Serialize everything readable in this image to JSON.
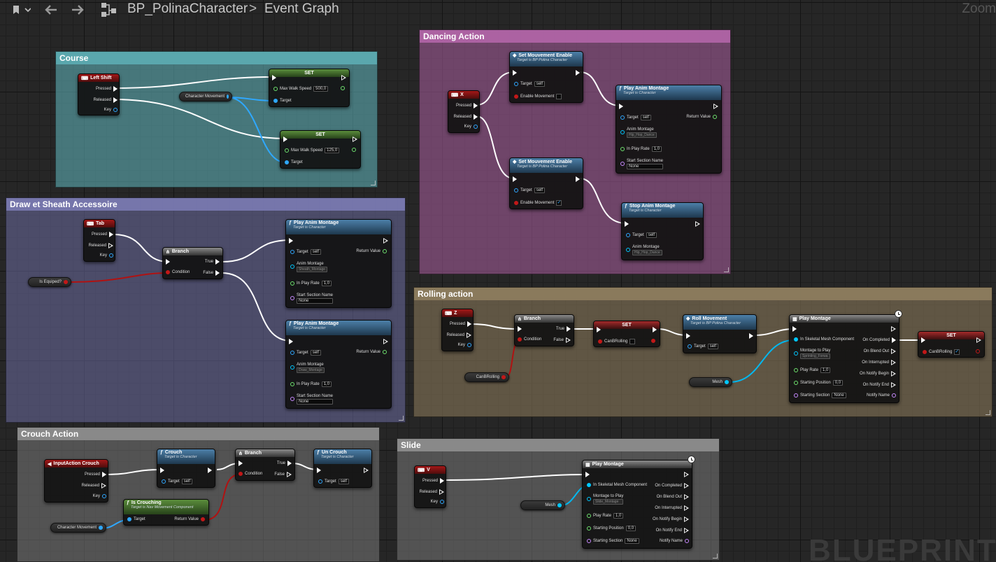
{
  "topbar": {
    "asset": "BP_PolinaCharacter",
    "graph": "Event Graph",
    "zoom": "Zoom"
  },
  "comments": {
    "course": "Course",
    "draw": "Draw et Sheath Accessoire",
    "dancing": "Dancing Action",
    "rolling": "Rolling action",
    "crouch": "Crouch Action",
    "slide": "Slide"
  },
  "labels": {
    "pressed": "Pressed",
    "released": "Released",
    "key": "Key",
    "set": "SET",
    "branch": "Branch",
    "true": "True",
    "false": "False",
    "condition": "Condition",
    "target": "Target",
    "self": "self",
    "max_walk_speed": "Max Walk Speed",
    "return_value": "Return Value",
    "anim_montage": "Anim Montage",
    "in_play_rate": "In Play Rate",
    "start_section_name": "Start Section Name",
    "none": "None",
    "rate_1": "1,0",
    "enable_movement": "Enable Movement",
    "target_is_bp": "Target is BP Polina Character",
    "target_is_character": "Target is Character",
    "target_is_nav": "Target is Nav Movement Component",
    "in_skeletal_mesh": "In Skeletal Mesh Component",
    "montage_to_play": "Montage to Play",
    "play_rate": "Play Rate",
    "starting_position": "Starting Position",
    "starting_position_val": "0,0",
    "starting_section": "Starting Section",
    "on_completed": "On Completed",
    "on_blend_out": "On Blend Out",
    "on_interrupted": "On Interrupted",
    "on_notify_begin": "On Notify Begin",
    "on_notify_end": "On Notify End",
    "notify_name": "Notify Name"
  },
  "course": {
    "event": "Left Shift",
    "var": "Character Movement",
    "speed1": "500,0",
    "speed2": "125,0"
  },
  "draw": {
    "event": "Tab",
    "var": "Is Equiped?",
    "montage1": "Sheath_Montage",
    "montage2": "Draw_Montage"
  },
  "dancing": {
    "event": "X",
    "set_move": "Set Mouvement Enable",
    "play": "Play Anim Montage",
    "stop": "Stop Anim Montage",
    "montage": "Hip_Hop_Dance"
  },
  "rolling": {
    "event": "Z",
    "var": "CanBRolling",
    "mesh": "Mesh",
    "roll": "Roll Movement",
    "play": "Play Montage",
    "montage": "Sprinting_Forwa"
  },
  "crouch": {
    "event": "InputAction Crouch",
    "crouch": "Crouch",
    "uncrouch": "Un Crouch",
    "is_crouching": "Is Crouching",
    "var": "Character Movement"
  },
  "slide": {
    "event": "V",
    "mesh": "Mesh",
    "play": "Play Montage",
    "montage": "Slide_Montage"
  },
  "watermark": "BLUEPRINT"
}
